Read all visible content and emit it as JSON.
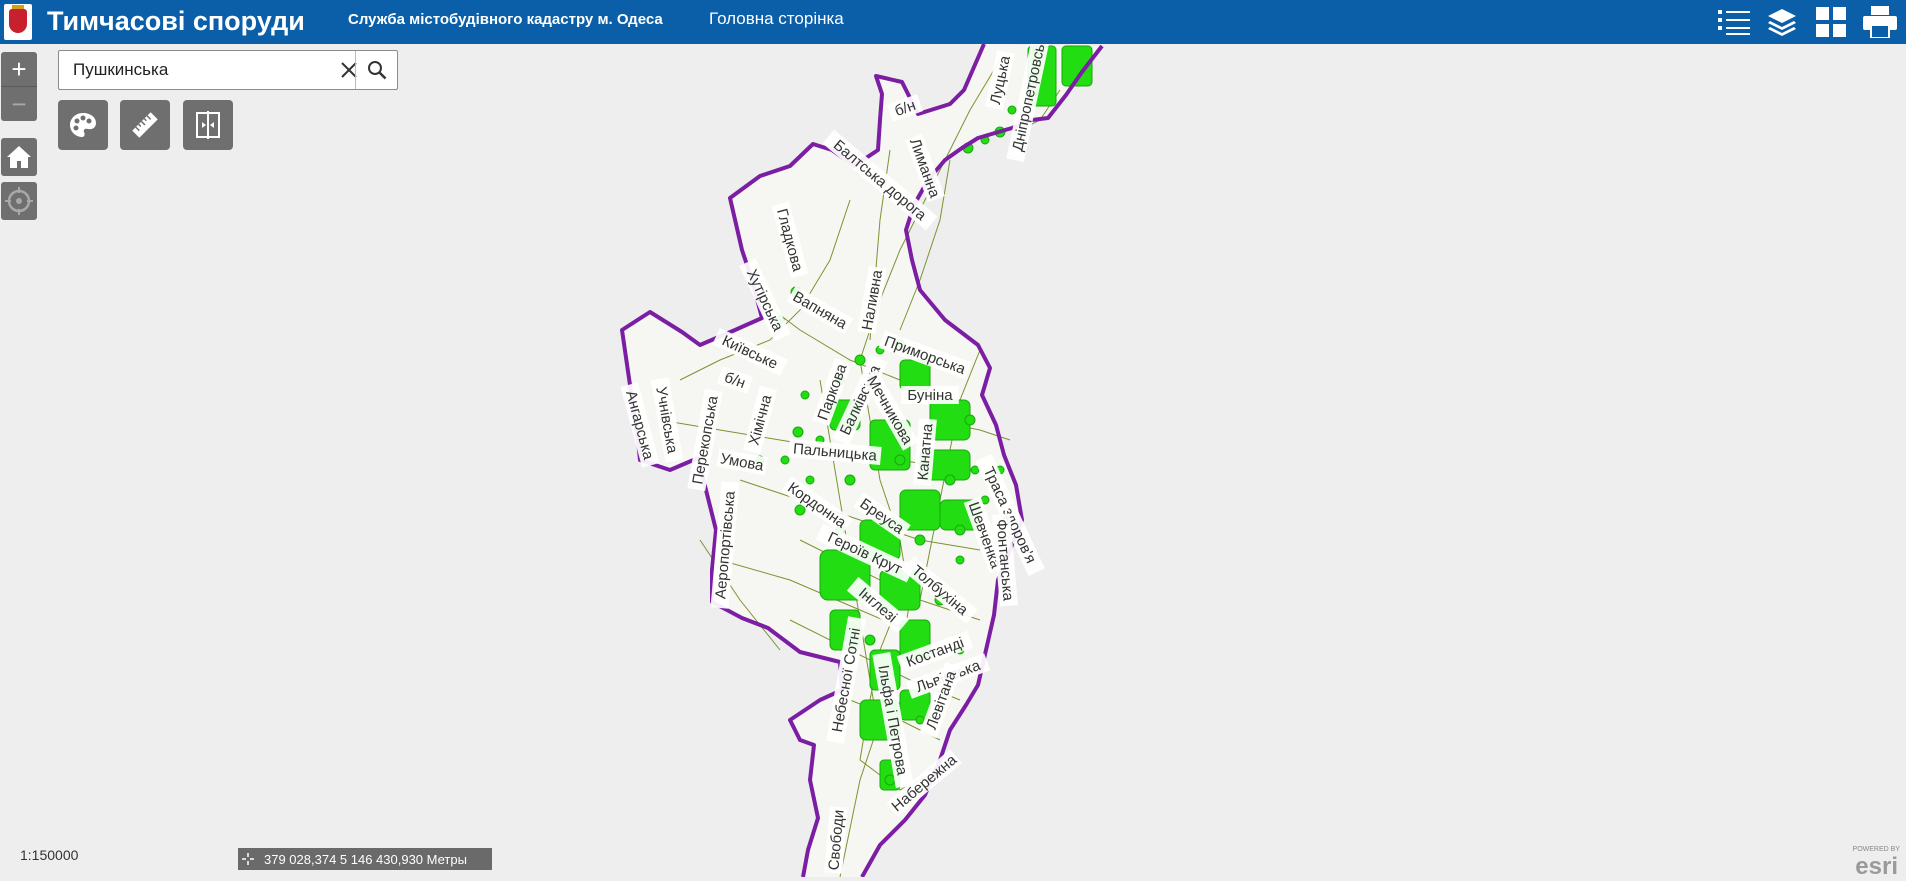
{
  "header": {
    "title": "Тимчасові споруди",
    "org": "Служба містобудівного кадастру м. Одеса",
    "home_link": "Головна сторінка",
    "icons": [
      "legend-icon",
      "layers-icon",
      "basemap-gallery-icon",
      "print-icon"
    ]
  },
  "search": {
    "value": "Пушкинська"
  },
  "tools": [
    "symbology-icon",
    "measure-icon",
    "swipe-icon"
  ],
  "zoom": {
    "plus": "+",
    "minus": "−"
  },
  "scale": "1:150000",
  "coords": "379 028,374 5 146 430,930 Метры",
  "logo": {
    "powered_by": "POWERED BY",
    "name": "esri"
  },
  "colors": {
    "header": "#0a5fa8",
    "boundary": "#7b1ea3",
    "features": "#22dd11",
    "streets": "#6e8a1e"
  },
  "map_labels": [
    "Луцька",
    "Дніпропетровська",
    "б/н",
    "Лиманна",
    "Балтська дорога",
    "Гладкова",
    "Хутірська",
    "Наливна",
    "Вапняна",
    "Київське",
    "Приморська",
    "б/н",
    "Паркова",
    "Балківська",
    "Мечникова",
    "Буніна",
    "Ангарська",
    "Учнівська",
    "Хімічна",
    "Перекопська",
    "Умова",
    "Пальницька",
    "Канатна",
    "Траса здоров'я",
    "Кордонна",
    "Бреуса",
    "Шевченка",
    "Аеропортівська",
    "Героїв Крут",
    "Толбухіна",
    "Фонтанська",
    "Інглезі",
    "Небесної Сотні",
    "Костанді",
    "Львівська",
    "Левітана",
    "Ільфа і Петрова",
    "Набережна",
    "Свободи"
  ]
}
